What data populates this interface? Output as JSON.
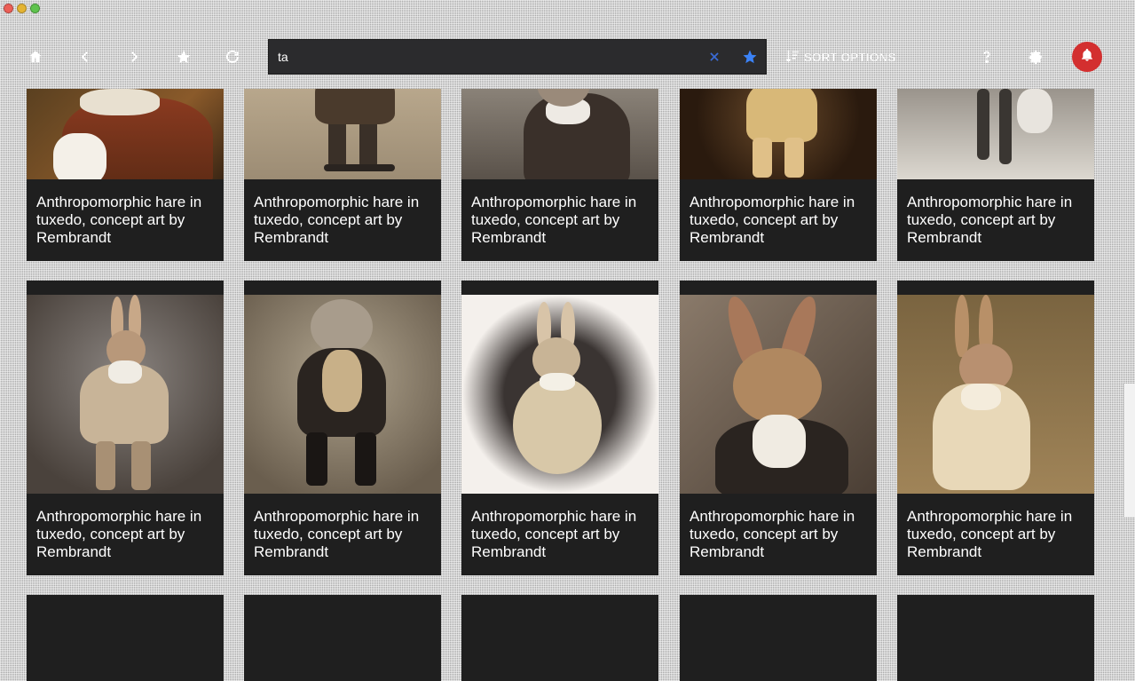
{
  "window": {
    "controls": [
      "close",
      "minimize",
      "maximize"
    ]
  },
  "toolbar": {
    "icons": {
      "home": "home-icon",
      "back": "chevron-left-icon",
      "forward": "chevron-right-icon",
      "favorite": "star-icon",
      "refresh": "refresh-icon",
      "help": "help-icon",
      "settings": "gear-icon",
      "notifications": "bell-icon"
    },
    "search": {
      "value": "ta",
      "placeholder": ""
    },
    "sort_label": "SORT OPTIONS",
    "colors": {
      "search_bg": "#2b2b2d",
      "accent_blue": "#3b82f6",
      "notification_red": "#d32f2f",
      "card_bg": "#1f1f1f"
    }
  },
  "gallery": {
    "cards": [
      {
        "caption": "Anthropomorphic hare in tuxedo, concept art by Rembrandt"
      },
      {
        "caption": "Anthropomorphic hare in tuxedo, concept art by Rembrandt"
      },
      {
        "caption": "Anthropomorphic hare in tuxedo, concept art by Rembrandt"
      },
      {
        "caption": "Anthropomorphic hare in tuxedo, concept art by Rembrandt"
      },
      {
        "caption": "Anthropomorphic hare in tuxedo, concept art by Rembrandt"
      },
      {
        "caption": "Anthropomorphic hare in tuxedo, concept art by Rembrandt"
      },
      {
        "caption": "Anthropomorphic hare in tuxedo, concept art by Rembrandt"
      },
      {
        "caption": "Anthropomorphic hare in tuxedo, concept art by Rembrandt"
      },
      {
        "caption": "Anthropomorphic hare in tuxedo, concept art by Rembrandt"
      },
      {
        "caption": "Anthropomorphic hare in tuxedo, concept art by Rembrandt"
      },
      {
        "caption": ""
      },
      {
        "caption": ""
      },
      {
        "caption": ""
      },
      {
        "caption": ""
      },
      {
        "caption": ""
      }
    ]
  }
}
